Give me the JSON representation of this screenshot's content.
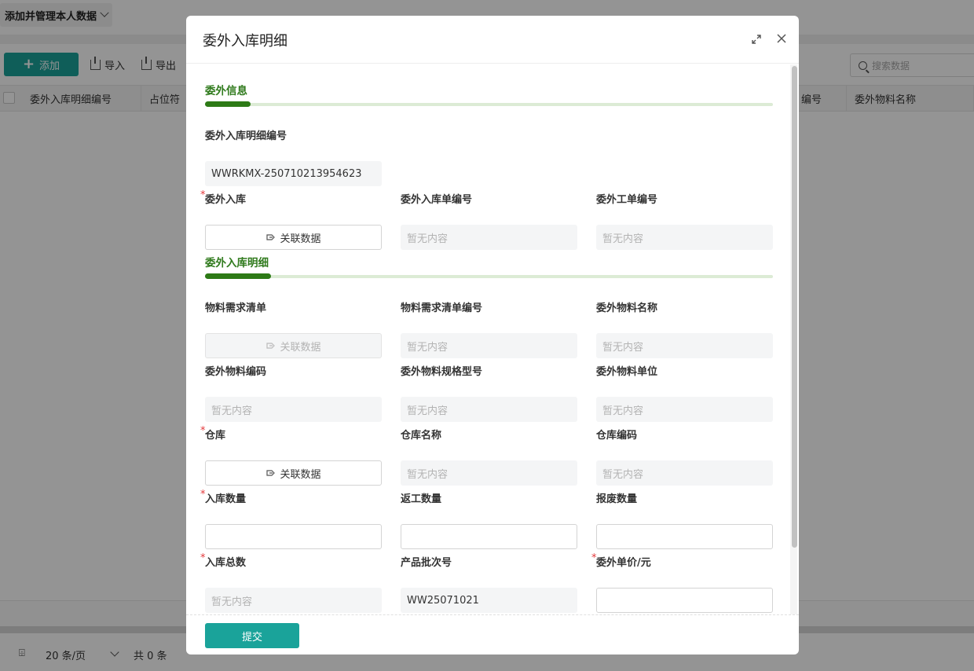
{
  "background": {
    "view_switch": "添加并管理本人数据",
    "toolbar": {
      "add": "添加",
      "import": "导入",
      "export": "导出"
    },
    "search_placeholder": "搜索数据",
    "columns": [
      "委外入库明细编号",
      "占位符",
      "编号",
      "委外物料名称"
    ],
    "pager": {
      "items_per_page": "20 条/页",
      "total": "共 0 条"
    }
  },
  "modal": {
    "title": "委外入库明细",
    "sections": {
      "info": "委外信息",
      "detail": "委外入库明细"
    },
    "relate_label": "关联数据",
    "empty_text": "暂无内容",
    "fields": {
      "detail_no": {
        "label": "委外入库明细编号",
        "value": "WWRKMX-250710213954623"
      },
      "inbound": {
        "label": "委外入库"
      },
      "inbound_no": {
        "label": "委外入库单编号"
      },
      "order_no": {
        "label": "委外工单编号"
      },
      "bom": {
        "label": "物料需求清单"
      },
      "bom_no": {
        "label": "物料需求清单编号"
      },
      "material_name": {
        "label": "委外物料名称"
      },
      "material_code": {
        "label": "委外物料编码"
      },
      "material_spec": {
        "label": "委外物料规格型号"
      },
      "material_unit": {
        "label": "委外物料单位"
      },
      "warehouse": {
        "label": "仓库"
      },
      "warehouse_name": {
        "label": "仓库名称"
      },
      "warehouse_code": {
        "label": "仓库编码"
      },
      "in_qty": {
        "label": "入库数量"
      },
      "rework_qty": {
        "label": "返工数量"
      },
      "scrap_qty": {
        "label": "报废数量"
      },
      "in_total": {
        "label": "入库总数"
      },
      "batch_no": {
        "label": "产品批次号",
        "value": "WW25071021"
      },
      "unit_price": {
        "label": "委外单价/元"
      }
    },
    "submit": "提交"
  },
  "colors": {
    "accent": "#1aa39a",
    "section_green": "#2d7a16",
    "required": "#e4393c"
  }
}
